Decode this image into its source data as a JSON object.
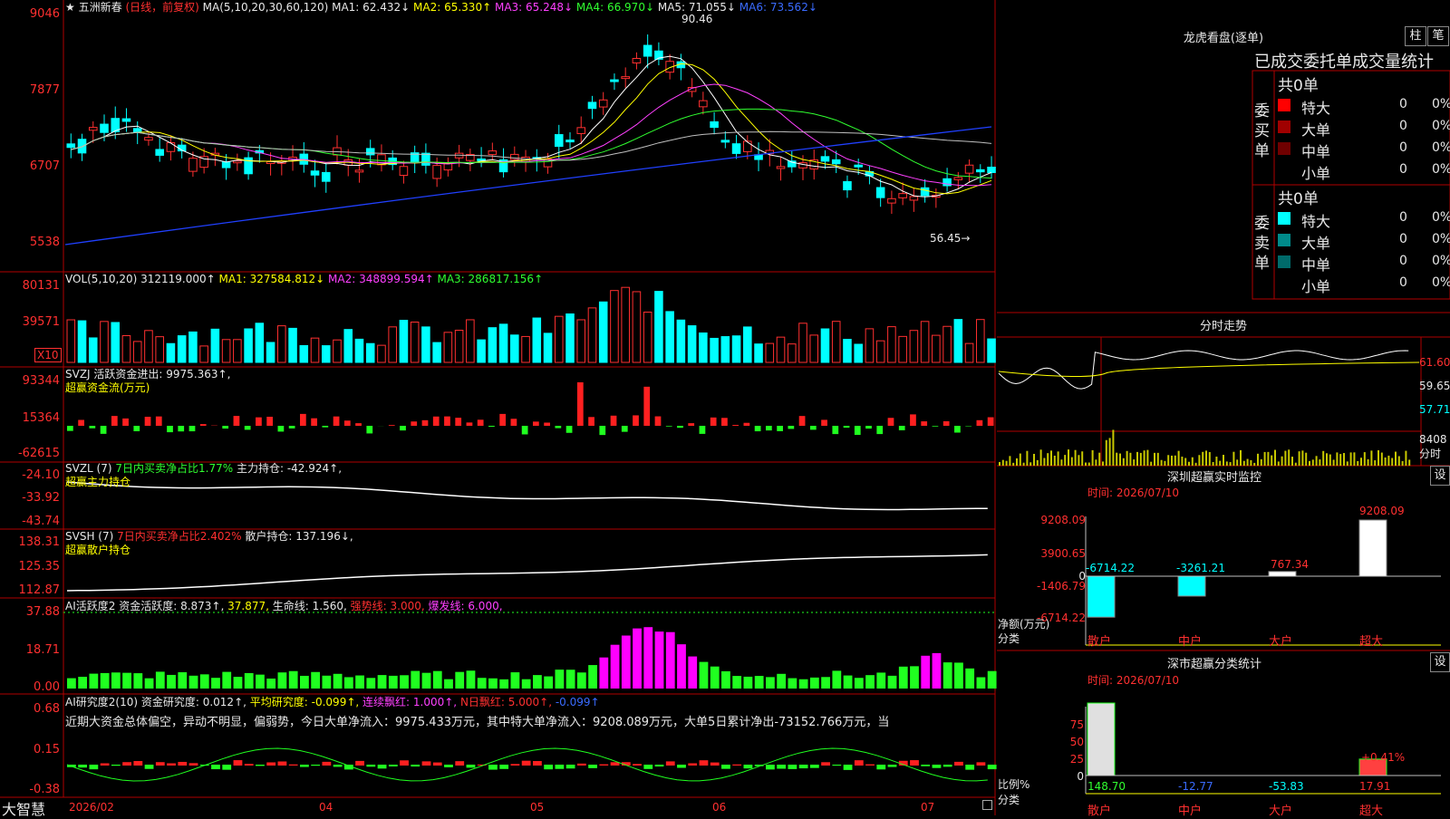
{
  "header": {
    "star": "★",
    "name": "五洲新春",
    "mode": "(日线，前复权)",
    "ma_label": "MA(5,10,20,30,60,120)",
    "ma1": "MA1: 62.432↓",
    "ma2": "MA2: 65.330↑",
    "ma3": "MA3: 65.248↓",
    "ma4": "MA4: 66.970↓",
    "ma5": "MA5: 71.055↓",
    "ma6": "MA6: 73.562↓",
    "high_label": "90.46",
    "low_label": "56.45→"
  },
  "price_axis": [
    "9046",
    "7877",
    "6707",
    "5538"
  ],
  "vol": {
    "label": "VOL(5,10,20)",
    "value": "312119.000↑",
    "ma1": "MA1: 327584.812↓",
    "ma2": "MA2: 348899.594↑",
    "ma3": "MA3: 286817.156↑",
    "axis": [
      "80131",
      "39571"
    ],
    "unit": "X10"
  },
  "svzj": {
    "label": "SVZJ",
    "text": "活跃资金进出: 9975.363↑,",
    "sub": "超赢资金流(万元)",
    "axis": [
      "93344",
      "15364",
      "-62615"
    ]
  },
  "svzl": {
    "label": "SVZL (7)",
    "text1": "7日内买卖净占比1.77%",
    "text2": "主力持仓: -42.924↑,",
    "sub": "超赢主力持仓",
    "axis": [
      "-24.10",
      "-33.92",
      "-43.74"
    ]
  },
  "svsh": {
    "label": "SVSH (7)",
    "text1": "7日内买卖净占比2.402%",
    "text2": "散户持仓: 137.196↓,",
    "sub": "超赢散户持仓",
    "axis": [
      "138.31",
      "125.35",
      "112.87"
    ]
  },
  "ai1": {
    "label": "AI活跃度2",
    "text1": "资金活跃度: 8.873↑,",
    "text2": "37.877,",
    "text3": "生命线: 1.560,",
    "text4": "强势线: 3.000,",
    "text5": "爆发线: 6.000,",
    "axis": [
      "37.88",
      "18.71",
      "0.00"
    ]
  },
  "ai2": {
    "label": "AI研究度2(10)",
    "text1": "资金研究度: 0.012↑,",
    "text2": "平均研究度: -0.099↑,",
    "text3": "连续飘红: 1.000↑,",
    "text4": "N日飘红: 5.000↑,",
    "text5": "-0.099↑",
    "comment": "近期大资金总体偏空，异动不明显，偏弱势，今日大单净流入：9975.433万元，其中特大单净流入：9208.089万元，大单5日累计净出-73152.766万元，当",
    "axis": [
      "0.68",
      "0.15",
      "-0.38"
    ]
  },
  "bottom": {
    "brand": "大智慧",
    "dates": [
      "2026/02",
      "04",
      "05",
      "06",
      "07"
    ]
  },
  "lhb": {
    "title": "龙虎看盘(逐单)",
    "btn1": "柱",
    "btn2": "笔",
    "heading": "已成交委托单成交量统计",
    "buy_side": "委买单",
    "sell_side": "委卖单",
    "buy_total": "共0单",
    "sell_total": "共0单",
    "rows": [
      {
        "label": "特大",
        "count": "0",
        "pct": "0%",
        "color": "#ff0000"
      },
      {
        "label": "大单",
        "count": "0",
        "pct": "0%",
        "color": "#a00000"
      },
      {
        "label": "中单",
        "count": "0",
        "pct": "0%",
        "color": "#700000"
      },
      {
        "label": "小单",
        "count": "0",
        "pct": "0%",
        "color": ""
      }
    ],
    "sell_rows": [
      {
        "label": "特大",
        "count": "0",
        "pct": "0%",
        "color": "#00ffff"
      },
      {
        "label": "大单",
        "count": "0",
        "pct": "0%",
        "color": "#008a8a"
      },
      {
        "label": "中单",
        "count": "0",
        "pct": "0%",
        "color": "#006a6a"
      },
      {
        "label": "小单",
        "count": "0",
        "pct": "0%",
        "color": ""
      }
    ]
  },
  "intraday": {
    "title": "分时走势",
    "axis": [
      "61.60",
      "59.65",
      "57.71"
    ],
    "vol_axis": [
      "8408",
      "分时"
    ]
  },
  "sz_monitor": {
    "title": "深圳超赢实时监控",
    "btn": "设",
    "time": "时间: 2026/07/10",
    "y_axis": [
      "9208.09",
      "3900.65",
      "0",
      "-1406.79",
      "-6714.22"
    ],
    "axis_title": [
      "净额(万元)",
      "分类"
    ],
    "categories": [
      "散户",
      "中户",
      "大户",
      "超大"
    ],
    "values": [
      -6714.22,
      -3261.21,
      767.34,
      9208.09
    ],
    "value_labels": [
      "-6714.22",
      "-3261.21",
      "767.34",
      "9208.09"
    ]
  },
  "sz_class": {
    "title": "深市超赢分类统计",
    "btn": "设",
    "time": "时间: 2026/07/10",
    "y_axis": [
      "75",
      "50",
      "25",
      "0"
    ],
    "axis_title": [
      "比例%",
      "分类"
    ],
    "categories": [
      "散户",
      "中户",
      "大户",
      "超大"
    ],
    "values": [
      148.7,
      -12.77,
      -53.83,
      17.91
    ],
    "value_labels": [
      "148.70",
      "-12.77",
      "-53.83",
      "17.91"
    ],
    "note": "+0.41%"
  }
}
